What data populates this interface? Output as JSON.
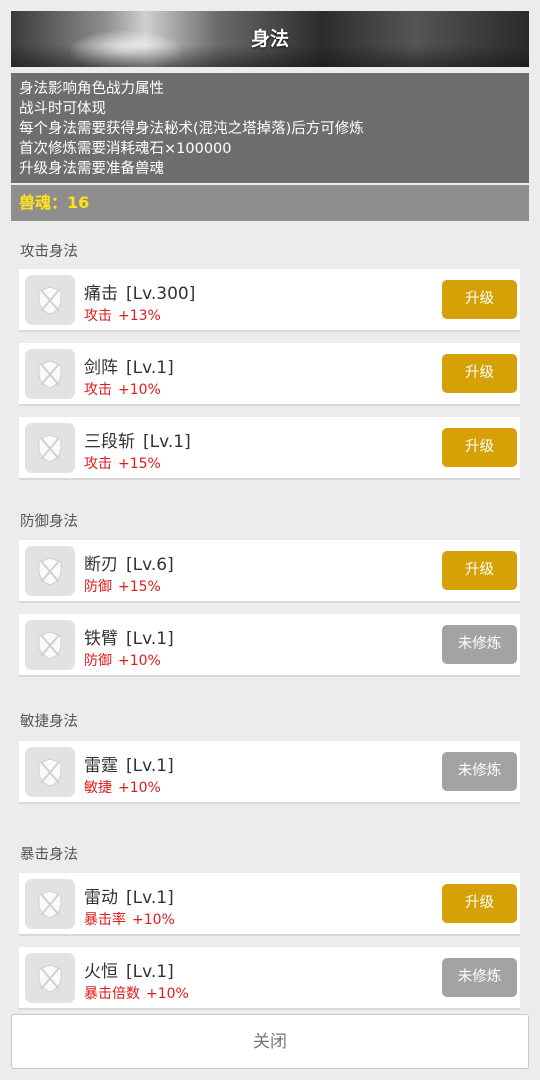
{
  "header": {
    "title": "身法"
  },
  "info_lines": [
    "身法影响角色战力属性",
    "战斗时可体现",
    "每个身法需要获得身法秘术(混沌之塔掉落)后方可修炼",
    "首次修炼需要消耗魂石×100000",
    "升级身法需要准备兽魂"
  ],
  "soul": {
    "label": "兽魂：",
    "value": "16"
  },
  "colors": {
    "upgrade": "#d6a106",
    "locked": "#a3a3a3",
    "effect": "#e01b1b",
    "soul": "#ffe21a"
  },
  "sections": [
    {
      "title": "攻击身法",
      "skills": [
        {
          "name": "痛击",
          "level": "[Lv.300]",
          "stat": "攻击",
          "amount": "+13%",
          "button": "升级",
          "state": "upgrade"
        },
        {
          "name": "剑阵",
          "level": "[Lv.1]",
          "stat": "攻击",
          "amount": "+10%",
          "button": "升级",
          "state": "upgrade"
        },
        {
          "name": "三段斩",
          "level": "[Lv.1]",
          "stat": "攻击",
          "amount": "+15%",
          "button": "升级",
          "state": "upgrade"
        }
      ]
    },
    {
      "title": "防御身法",
      "skills": [
        {
          "name": "断刃",
          "level": "[Lv.6]",
          "stat": "防御",
          "amount": "+15%",
          "button": "升级",
          "state": "upgrade"
        },
        {
          "name": "铁臂",
          "level": "[Lv.1]",
          "stat": "防御",
          "amount": "+10%",
          "button": "未修炼",
          "state": "locked"
        }
      ]
    },
    {
      "title": "敏捷身法",
      "skills": [
        {
          "name": "雷霆",
          "level": "[Lv.1]",
          "stat": "敏捷",
          "amount": "+10%",
          "button": "未修炼",
          "state": "locked"
        }
      ]
    },
    {
      "title": "暴击身法",
      "skills": [
        {
          "name": "雷动",
          "level": "[Lv.1]",
          "stat": "暴击率",
          "amount": "+10%",
          "button": "升级",
          "state": "upgrade"
        },
        {
          "name": "火恒",
          "level": "[Lv.1]",
          "stat": "暴击倍数",
          "amount": "+10%",
          "button": "未修炼",
          "state": "locked"
        }
      ]
    }
  ],
  "skill_icon": "crossed-swords-shield-icon",
  "close_label": "关闭"
}
